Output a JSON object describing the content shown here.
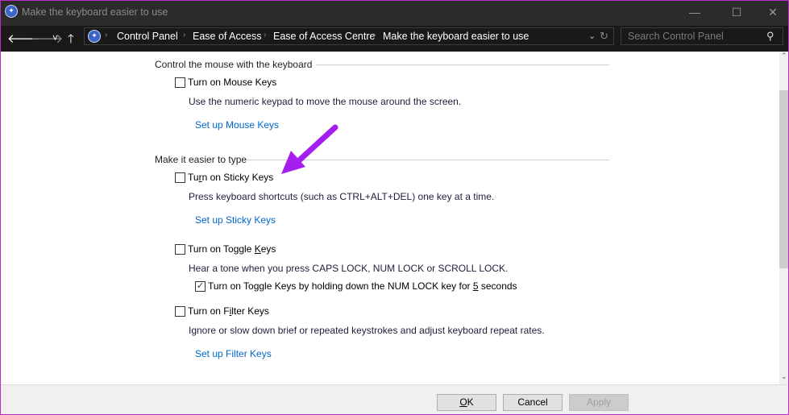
{
  "window": {
    "title": "Make the keyboard easier to use",
    "controls": {
      "minimize": "—",
      "maximize": "☐",
      "close": "✕"
    }
  },
  "nav": {
    "back": "🡐",
    "forward": "🡒",
    "recent": "˅",
    "up": "🡑"
  },
  "breadcrumb": [
    "Control Panel",
    "Ease of Access",
    "Ease of Access Centre",
    "Make the keyboard easier to use"
  ],
  "search": {
    "placeholder": "Search Control Panel"
  },
  "sections": {
    "mouse": {
      "header": "Control the mouse with the keyboard",
      "mouse_keys": {
        "pre": "Turn on Mouse Keys",
        "accel": "",
        "post": "",
        "checked": false,
        "desc": "Use the numeric keypad to move the mouse around the screen.",
        "link": "Set up Mouse Keys"
      }
    },
    "type": {
      "header": "Make it easier to type",
      "sticky": {
        "pre": "Tu",
        "accel": "r",
        "post": "n on Sticky Keys",
        "checked": false,
        "desc": "Press keyboard shortcuts (such as CTRL+ALT+DEL) one key at a time.",
        "link": "Set up Sticky Keys"
      },
      "toggle": {
        "pre": "Turn on Toggle ",
        "accel": "K",
        "post": "eys",
        "checked": false,
        "desc": "Hear a tone when you press CAPS LOCK, NUM LOCK or SCROLL LOCK.",
        "sub": {
          "pre": "Turn on Toggle Keys by holding down the NUM LOCK key for ",
          "accel": "5",
          "post": " seconds",
          "checked": true
        }
      },
      "filter": {
        "pre": "Turn on F",
        "accel": "i",
        "post": "lter Keys",
        "checked": false,
        "desc": "Ignore or slow down brief or repeated keystrokes and adjust keyboard repeat rates.",
        "link": "Set up Filter Keys"
      }
    }
  },
  "annotation": {
    "arrow_color": "#a51ef0"
  },
  "footer": {
    "ok_pre": "",
    "ok_accel": "O",
    "ok_post": "K",
    "cancel": "Cancel",
    "apply": "Apply",
    "apply_enabled": false
  }
}
